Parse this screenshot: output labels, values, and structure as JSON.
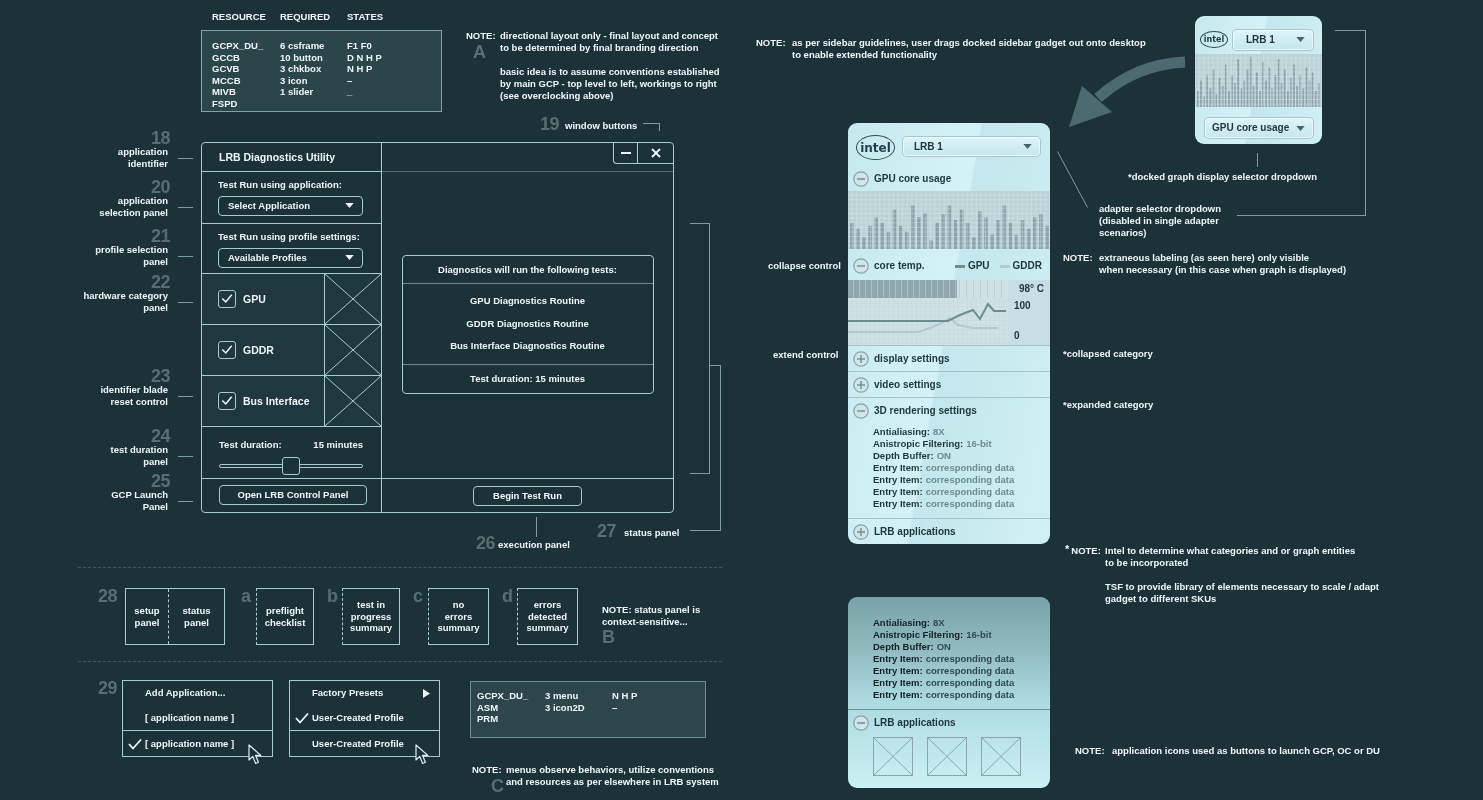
{
  "resource_table": {
    "columns": [
      "RESOURCE",
      "REQUIRED",
      "STATES"
    ],
    "rows": [
      [
        "GCPX_DU_",
        "6 csframe",
        "F1 F0"
      ],
      [
        "GCCB",
        "10 button",
        "D N H P"
      ],
      [
        "GCVB",
        "3 chkbox",
        "N H P"
      ],
      [
        "MCCB",
        "3 icon",
        "–"
      ],
      [
        "MIVB",
        "1 slider",
        "_"
      ],
      [
        "FSPD"
      ]
    ]
  },
  "note_a": {
    "label": "NOTE:",
    "marker": "A",
    "paragraphs": [
      "directional layout only - final layout and concept\nto be determined by final branding direction",
      "basic idea is to assume conventions established\nby main GCP - top level to left, workings to right\n(see overclocking above)"
    ]
  },
  "window_buttons_callout": {
    "number": "19",
    "label": "window buttons"
  },
  "callouts": [
    {
      "number": "18",
      "label": "application\nidentifier"
    },
    {
      "number": "20",
      "label": "application\nselection panel"
    },
    {
      "number": "21",
      "label": "profile selection\npanel"
    },
    {
      "number": "22",
      "label": "hardware category\npanel"
    },
    {
      "number": "23",
      "label": "identifier blade\nreset control"
    },
    {
      "number": "24",
      "label": "test duration\npanel"
    },
    {
      "number": "25",
      "label": "GCP Launch\nPanel"
    }
  ],
  "window": {
    "title": "LRB Diagnostics Utility",
    "application_panel": {
      "label": "Test Run using application:",
      "dropdown": "Select Application"
    },
    "profile_panel": {
      "label": "Test Run using profile settings:",
      "dropdown": "Available Profiles"
    },
    "hardware": [
      {
        "label": "GPU",
        "checked": true
      },
      {
        "label": "GDDR",
        "checked": true
      },
      {
        "label": "Bus Interface",
        "checked": true
      }
    ],
    "duration": {
      "label": "Test duration:",
      "value": "15 minutes",
      "level": 0.5
    },
    "launch_button": "Open LRB Control Panel",
    "tests_panel": {
      "heading": "Diagnostics will run the following tests:",
      "tests": [
        "GPU Diagnostics Routine",
        "GDDR Diagnostics Routine",
        "Bus Interface Diagnostics Routine"
      ],
      "footer": "Test duration: 15 minutes"
    },
    "run_button": "Begin Test Run"
  },
  "execution_callout": {
    "number": "26",
    "label": "execution panel"
  },
  "status_callout": {
    "number": "27",
    "label": "status panel"
  },
  "status_states": {
    "number": "28",
    "combined": [
      "setup\npanel",
      "status\npanel"
    ],
    "variants": [
      {
        "marker": "a",
        "label": "preflight\nchecklist"
      },
      {
        "marker": "b",
        "label": "test in\nprogress\nsummary"
      },
      {
        "marker": "c",
        "label": "no\nerrors\nsummary"
      },
      {
        "marker": "d",
        "label": "errors\ndetected\nsummary"
      }
    ]
  },
  "note_b": {
    "text": "NOTE: status panel is\ncontext-sensitive...",
    "marker": "B"
  },
  "menus": {
    "number": "29",
    "lists": [
      {
        "items": [
          {
            "label": "Add Application...",
            "checked": false,
            "selected": false,
            "submenu": false
          },
          {
            "label": "[ application name ]",
            "checked": false,
            "selected": false,
            "submenu": false
          },
          {
            "label": "[ application name ]",
            "checked": true,
            "selected": true,
            "submenu": false
          }
        ]
      },
      {
        "items": [
          {
            "label": "Factory Presets",
            "checked": false,
            "selected": false,
            "submenu": true
          },
          {
            "label": "User-Created Profile",
            "checked": true,
            "selected": false,
            "submenu": false
          },
          {
            "label": "User-Created Profile",
            "checked": false,
            "selected": true,
            "submenu": false
          }
        ]
      }
    ]
  },
  "menu_resource_table": {
    "rows": [
      [
        "GCPX_DU_",
        "3 menu",
        "N H P"
      ],
      [
        "ASM",
        "3 icon2D",
        "–"
      ],
      [
        "PRM"
      ]
    ]
  },
  "note_c": {
    "label": "NOTE:",
    "marker": "C",
    "text": "menus observe behaviors, utilize conventions\nand resources as per elsewhere in LRB system"
  },
  "note_drag": {
    "label": "NOTE:",
    "text": "as per sidebar guidelines, user drags docked sidebar gadget out onto desktop\nto enable extended functionality"
  },
  "docked_gadget": {
    "logo": "intel",
    "adapter": "LRB 1",
    "graph_selector": "GPU core usage"
  },
  "docked_label": "*docked graph display selector dropdown",
  "adapter_label": "adapter selector dropdown\n(disabled in single adapter\nscenarios)",
  "note_labeling": {
    "label": "NOTE:",
    "text": "extraneous labeling (as seen here) only visible\nwhen necessary (in this case when graph is displayed)"
  },
  "collapse_label": "collapse control",
  "extend_label": "extend control",
  "gadget": {
    "logo": "intel",
    "adapter": "LRB 1",
    "sections": [
      {
        "title": "GPU core usage",
        "expanded": true,
        "kind": "bars"
      },
      {
        "title": "core temp.",
        "expanded": true,
        "kind": "temperature",
        "legend": [
          {
            "label": "GPU",
            "color": "#6f8d91"
          },
          {
            "label": "GDDR",
            "color": "#b2cacd"
          }
        ],
        "reading": "98° C",
        "level": 0.68,
        "scale_max": "100",
        "scale_min": "0"
      },
      {
        "title": "display settings",
        "expanded": false,
        "kind": "settings"
      },
      {
        "title": "video settings",
        "expanded": false,
        "kind": "settings"
      },
      {
        "title": "3D rendering settings",
        "expanded": true,
        "kind": "settings",
        "entries": [
          {
            "key": "Antialiasing:",
            "value": "8X"
          },
          {
            "key": "Anistropic Filtering:",
            "value": "16-bit"
          },
          {
            "key": "Depth Buffer:",
            "value": "ON"
          },
          {
            "key": "Entry Item:",
            "value": "corresponding data"
          },
          {
            "key": "Entry Item:",
            "value": "corresponding data"
          },
          {
            "key": "Entry Item:",
            "value": "corresponding data"
          },
          {
            "key": "Entry Item:",
            "value": "corresponding data"
          }
        ]
      },
      {
        "title": "LRB applications",
        "expanded": false,
        "kind": "apps"
      }
    ]
  },
  "collapsed_label": "*collapsed category",
  "expanded_label": "*expanded category",
  "note_categories": {
    "marker": "*",
    "label": "NOTE:",
    "paragraphs": [
      "Intel to determine what categories and or graph entities\nto be incorporated",
      "TSF to provide library of elements necessary to scale / adapt\ngadget to different SKUs"
    ]
  },
  "gadget_detail": {
    "entries": [
      {
        "key": "Antialiasing:",
        "value": "8X"
      },
      {
        "key": "Anistropic Filtering:",
        "value": "16-bit"
      },
      {
        "key": "Depth Buffer:",
        "value": "ON"
      },
      {
        "key": "Entry Item:",
        "value": "corresponding data"
      },
      {
        "key": "Entry Item:",
        "value": "corresponding data"
      },
      {
        "key": "Entry Item:",
        "value": "corresponding data"
      },
      {
        "key": "Entry Item:",
        "value": "corresponding data"
      }
    ],
    "apps_section": {
      "title": "LRB applications",
      "expanded": true
    }
  },
  "note_apps": {
    "label": "NOTE:",
    "text": "application icons used as buttons to launch GCP, OC or DU"
  }
}
